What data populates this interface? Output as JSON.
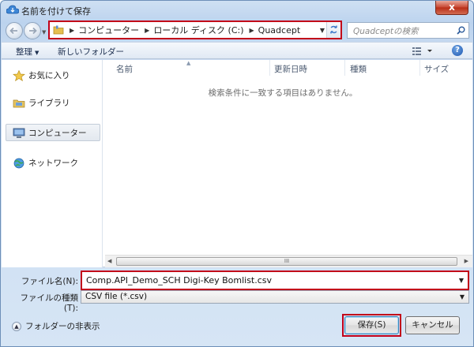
{
  "window": {
    "title": "名前を付けて保存",
    "close_glyph": "x"
  },
  "address": {
    "crumbs": [
      "コンピューター",
      "ローカル ディスク (C:)",
      "Quadcept"
    ]
  },
  "search": {
    "placeholder": "Quadceptの検索"
  },
  "toolbar": {
    "organize_label": "整理",
    "new_folder_label": "新しいフォルダー"
  },
  "sidebar": {
    "items": [
      {
        "label": "お気に入り",
        "icon": "star-icon"
      },
      {
        "label": "ライブラリ",
        "icon": "library-icon"
      },
      {
        "label": "コンピューター",
        "icon": "computer-icon",
        "selected": true
      },
      {
        "label": "ネットワーク",
        "icon": "network-icon"
      }
    ]
  },
  "file_list": {
    "columns": [
      "名前",
      "更新日時",
      "種類",
      "サイズ"
    ],
    "empty_message": "検索条件に一致する項目はありません。",
    "scroll_thumb_glyph": "III"
  },
  "form": {
    "filename_label": "ファイル名(N):",
    "filename_value": "Comp.API_Demo_SCH Digi-Key Bomlist.csv",
    "filetype_label": "ファイルの種類(T):",
    "filetype_value": "CSV file (*.csv)"
  },
  "footer": {
    "hide_folders_label": "フォルダーの非表示",
    "save_label": "保存(S)",
    "cancel_label": "キャンセル"
  },
  "colors": {
    "highlight_red": "#c20019",
    "title_gradient_top": "#cfe0f3"
  }
}
